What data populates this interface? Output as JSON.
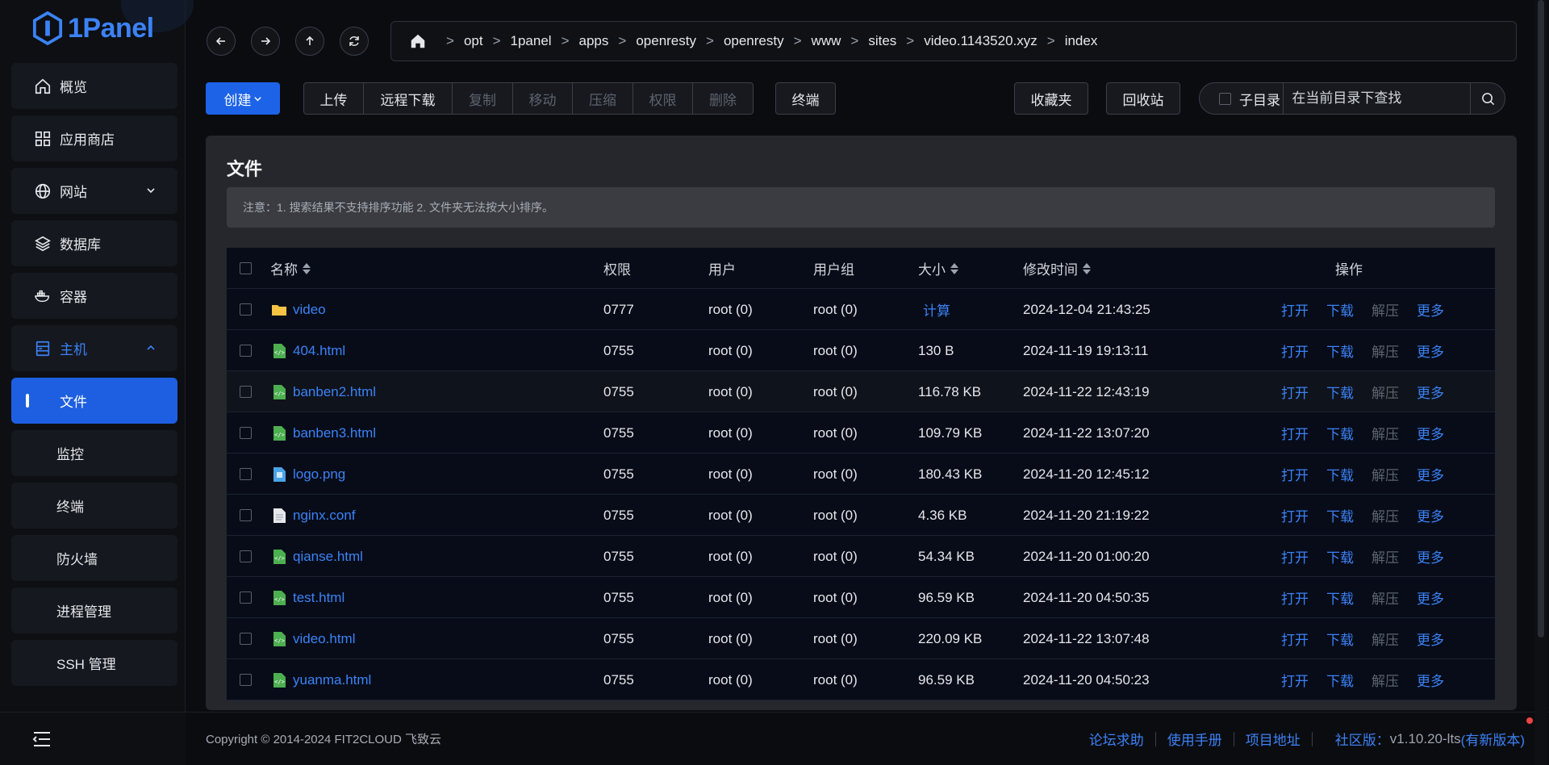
{
  "app": {
    "logo_text": "1Panel"
  },
  "sidebar": {
    "items": [
      {
        "label": "概览",
        "icon": "home-icon"
      },
      {
        "label": "应用商店",
        "icon": "apps-icon"
      },
      {
        "label": "网站",
        "icon": "globe-icon"
      },
      {
        "label": "数据库",
        "icon": "layers-icon"
      },
      {
        "label": "容器",
        "icon": "docker-icon"
      },
      {
        "label": "主机",
        "icon": "server-icon"
      }
    ],
    "host_submenu": [
      "文件",
      "监控",
      "终端",
      "防火墙",
      "进程管理",
      "SSH 管理"
    ]
  },
  "breadcrumb": [
    "opt",
    "1panel",
    "apps",
    "openresty",
    "openresty",
    "www",
    "sites",
    "video.1143520.xyz",
    "index"
  ],
  "breadcrumb_separator": ">",
  "toolbar": {
    "create_label": "创建",
    "group_buttons": [
      {
        "label": "上传",
        "enabled": true
      },
      {
        "label": "远程下载",
        "enabled": true
      },
      {
        "label": "复制",
        "enabled": false
      },
      {
        "label": "移动",
        "enabled": false
      },
      {
        "label": "压缩",
        "enabled": false
      },
      {
        "label": "权限",
        "enabled": false
      },
      {
        "label": "删除",
        "enabled": false
      }
    ],
    "terminal_label": "终端",
    "favorites_label": "收藏夹",
    "recycle_label": "回收站",
    "subdir_label": "子目录",
    "search_placeholder": "在当前目录下查找"
  },
  "card": {
    "title": "文件",
    "notice": "注意：1. 搜索结果不支持排序功能 2. 文件夹无法按大小排序。"
  },
  "table": {
    "headers": {
      "name": "名称",
      "perm": "权限",
      "user": "用户",
      "group": "用户组",
      "size": "大小",
      "time": "修改时间",
      "ops": "操作"
    },
    "rows": [
      {
        "name": "video",
        "type": "folder",
        "perm": "0777",
        "user": "root (0)",
        "group": "root (0)",
        "size": "计算",
        "time": "2024-12-04 21:43:25"
      },
      {
        "name": "404.html",
        "type": "html",
        "perm": "0755",
        "user": "root (0)",
        "group": "root (0)",
        "size": "130 B",
        "time": "2024-11-19 19:13:11"
      },
      {
        "name": "banben2.html",
        "type": "html",
        "perm": "0755",
        "user": "root (0)",
        "group": "root (0)",
        "size": "116.78 KB",
        "time": "2024-11-22 12:43:19"
      },
      {
        "name": "banben3.html",
        "type": "html",
        "perm": "0755",
        "user": "root (0)",
        "group": "root (0)",
        "size": "109.79 KB",
        "time": "2024-11-22 13:07:20"
      },
      {
        "name": "logo.png",
        "type": "image",
        "perm": "0755",
        "user": "root (0)",
        "group": "root (0)",
        "size": "180.43 KB",
        "time": "2024-11-20 12:45:12"
      },
      {
        "name": "nginx.conf",
        "type": "text",
        "perm": "0755",
        "user": "root (0)",
        "group": "root (0)",
        "size": "4.36 KB",
        "time": "2024-11-20 21:19:22"
      },
      {
        "name": "qianse.html",
        "type": "html",
        "perm": "0755",
        "user": "root (0)",
        "group": "root (0)",
        "size": "54.34 KB",
        "time": "2024-11-20 01:00:20"
      },
      {
        "name": "test.html",
        "type": "html",
        "perm": "0755",
        "user": "root (0)",
        "group": "root (0)",
        "size": "96.59 KB",
        "time": "2024-11-20 04:50:35"
      },
      {
        "name": "video.html",
        "type": "html",
        "perm": "0755",
        "user": "root (0)",
        "group": "root (0)",
        "size": "220.09 KB",
        "time": "2024-11-22 13:07:48"
      },
      {
        "name": "yuanma.html",
        "type": "html",
        "perm": "0755",
        "user": "root (0)",
        "group": "root (0)",
        "size": "96.59 KB",
        "time": "2024-11-20 04:50:23"
      }
    ],
    "ops": [
      {
        "label": "打开",
        "enabled": true
      },
      {
        "label": "下载",
        "enabled": true
      },
      {
        "label": "解压",
        "enabled": false
      },
      {
        "label": "更多",
        "enabled": true
      }
    ]
  },
  "footer": {
    "copyright": "Copyright © 2014-2024 FIT2CLOUD 飞致云",
    "links": [
      "论坛求助",
      "使用手册",
      "项目地址"
    ],
    "edition": "社区版：",
    "version": "v1.10.20-lts",
    "new_version": "(有新版本)"
  },
  "colors": {
    "accent": "#3b82f6",
    "active_bg": "#1d5fe0",
    "disabled": "#5d636e"
  }
}
